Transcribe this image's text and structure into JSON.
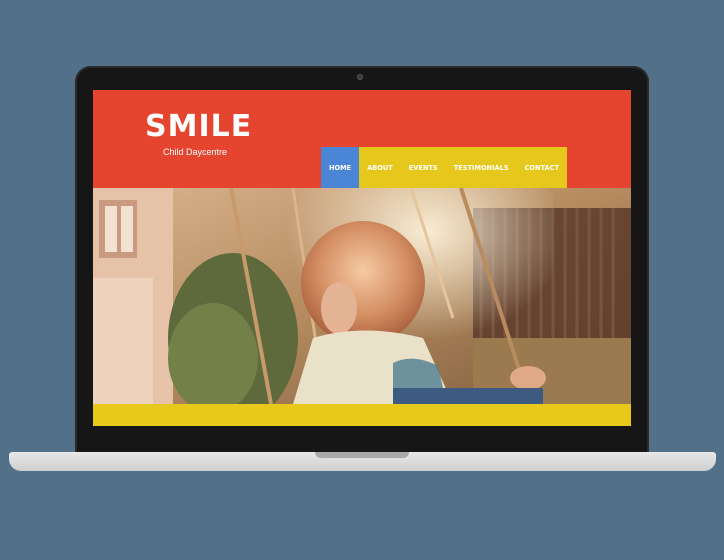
{
  "site": {
    "logo": "SMILE",
    "tagline": "Child Daycentre"
  },
  "nav": {
    "items": [
      {
        "label": "HOME",
        "active": true
      },
      {
        "label": "ABOUT",
        "active": false
      },
      {
        "label": "EVENTS",
        "active": false
      },
      {
        "label": "TESTIMONIALS",
        "active": false
      },
      {
        "label": "CONTACT",
        "active": false
      }
    ]
  },
  "colors": {
    "background": "#537089",
    "header": "#e5452f",
    "nav_item": "#e6c71c",
    "nav_active": "#4b86d6",
    "footer_bar": "#e8c81a"
  },
  "hero": {
    "image": "child-on-swing-photo"
  }
}
